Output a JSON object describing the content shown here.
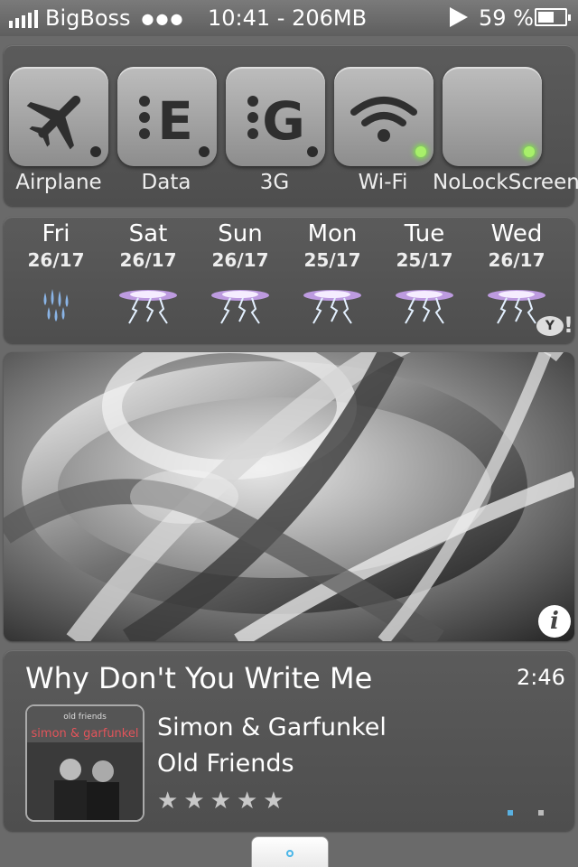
{
  "status_bar": {
    "carrier": "BigBoss",
    "dots": "●●●",
    "clock": "10:41 - 206MB",
    "battery": "59 %",
    "battery_level": 0.59
  },
  "toggles": [
    {
      "label": "Airplane",
      "icon": "airplane-icon",
      "active": false
    },
    {
      "label": "Data",
      "icon": "data-e-icon",
      "glyph": "E",
      "active": false
    },
    {
      "label": "3G",
      "icon": "3g-icon",
      "glyph": "G",
      "active": false
    },
    {
      "label": "Wi-Fi",
      "icon": "wifi-icon",
      "active": true
    },
    {
      "label": "NoLockScreen",
      "icon": "",
      "active": true
    }
  ],
  "weather": {
    "days": [
      {
        "name": "Fri",
        "temp": "26/17",
        "condition": "rain-icon"
      },
      {
        "name": "Sat",
        "temp": "26/17",
        "condition": "thunderstorm-icon"
      },
      {
        "name": "Sun",
        "temp": "26/17",
        "condition": "thunderstorm-icon"
      },
      {
        "name": "Mon",
        "temp": "25/17",
        "condition": "thunderstorm-icon"
      },
      {
        "name": "Tue",
        "temp": "25/17",
        "condition": "thunderstorm-icon"
      },
      {
        "name": "Wed",
        "temp": "26/17",
        "condition": "thunderstorm-icon"
      }
    ],
    "provider_badge": "Y",
    "provider_bang": "!"
  },
  "wallpaper": {
    "info_label": "i"
  },
  "music": {
    "title": "Why Don't You Write Me",
    "time": "2:46",
    "artist": "Simon & Garfunkel",
    "album": "Old Friends",
    "rating_stars": 5,
    "album_art_text_top": "old friends",
    "album_art_text_main": "simon & garfunkel"
  },
  "colors": {
    "led_on": "#a8f06a",
    "page_dot_active": "#59b0e0"
  }
}
